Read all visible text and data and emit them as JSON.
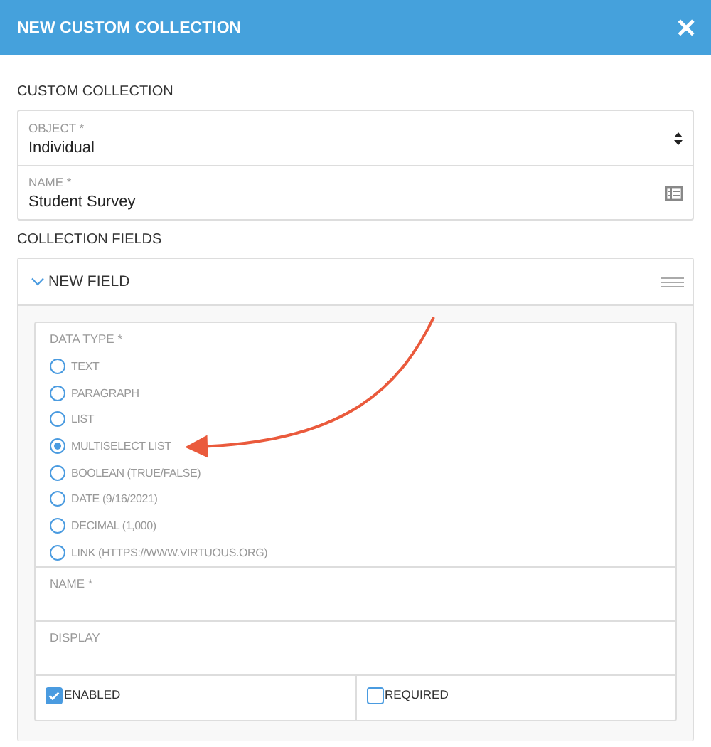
{
  "window": {
    "title": "NEW CUSTOM COLLECTION",
    "close": "✕"
  },
  "section_title": "CUSTOM COLLECTION",
  "collection_fields": [
    {
      "kind": "select",
      "label": "OBJECT *",
      "value": "Individual"
    },
    {
      "kind": "text",
      "label": "NAME *",
      "value": "Student Survey"
    }
  ],
  "fields_title": "COLLECTION FIELDS",
  "field_panel": {
    "title": "NEW FIELD",
    "expanded": true,
    "data_type": {
      "label": "DATA TYPE *",
      "options": [
        {
          "label": "TEXT",
          "selected": false
        },
        {
          "label": "PARAGRAPH",
          "selected": false
        },
        {
          "label": "LIST",
          "selected": false
        },
        {
          "label": "MULTISELECT LIST",
          "selected": true
        },
        {
          "label": "BOOLEAN (TRUE/FALSE)",
          "selected": false
        },
        {
          "label": "DATE (9/16/2021)",
          "selected": false
        },
        {
          "label": "DECIMAL (1,000)",
          "selected": false
        },
        {
          "label": "LINK (HTTPS://WWW.VIRTUOUS.ORG)",
          "selected": false
        }
      ]
    },
    "inputs": [
      {
        "label": "NAME *"
      },
      {
        "label": "DISPLAY"
      }
    ],
    "checkboxes": [
      {
        "label": "ENABLED",
        "checked": true
      },
      {
        "label": "REQUIRED",
        "checked": false
      }
    ]
  }
}
